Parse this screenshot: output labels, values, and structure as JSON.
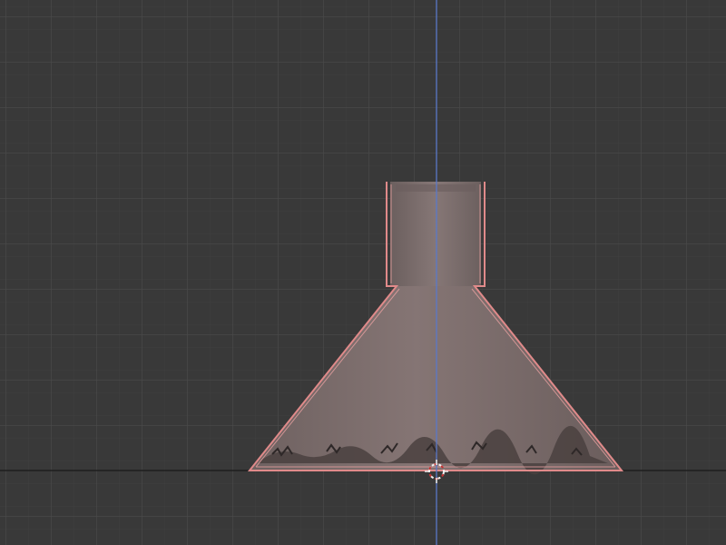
{
  "viewport": {
    "view": "front-orthographic",
    "mode": "object",
    "selected_object": "funnel-mesh",
    "selection_state": "selected",
    "grid": true
  },
  "colors": {
    "background": "#393939",
    "grid_major": "#4a4a4a",
    "grid_minor": "#404040",
    "axis_z": "#5a78c8",
    "floor_line": "#1e1e1e",
    "mesh_fill": "#7a6b6a",
    "mesh_shade": "#5e5352",
    "selection_outline": "#e08a8a",
    "cursor": "#f0f0f0"
  },
  "icons": {
    "cursor": "3d-cursor-icon"
  }
}
